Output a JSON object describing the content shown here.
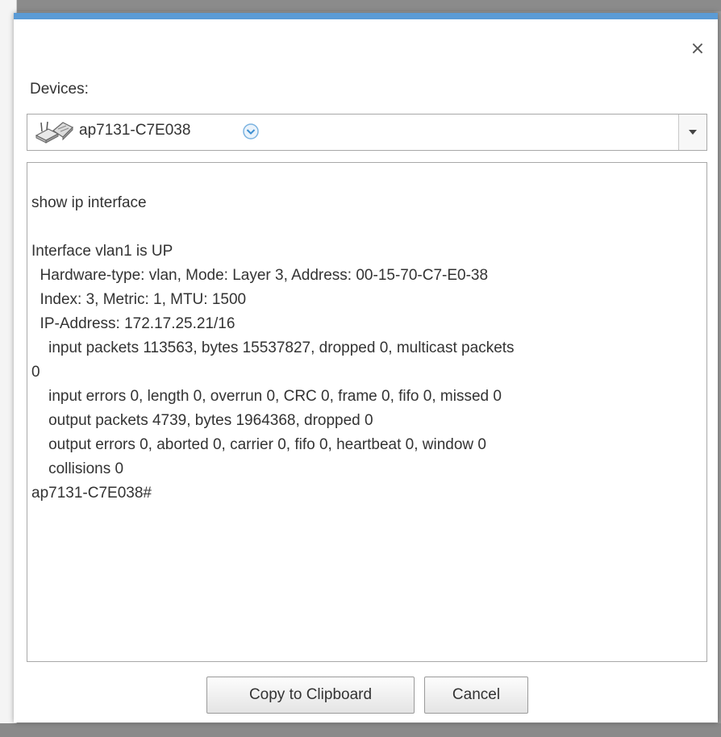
{
  "dialog": {
    "devices_label": "Devices:",
    "selected_device": "ap7131-C7E038",
    "device_icon": "access-point-icon",
    "output_lines": [
      "show ip interface",
      "",
      "Interface vlan1 is UP",
      "  Hardware-type: vlan, Mode: Layer 3, Address: 00-15-70-C7-E0-38",
      "  Index: 3, Metric: 1, MTU: 1500",
      "  IP-Address: 172.17.25.21/16",
      "    input packets 113563, bytes 15537827, dropped 0, multicast packets",
      "0",
      "    input errors 0, length 0, overrun 0, CRC 0, frame 0, fifo 0, missed 0",
      "    output packets 4739, bytes 1964368, dropped 0",
      "    output errors 0, aborted 0, carrier 0, fifo 0, heartbeat 0, window 0",
      "    collisions 0",
      "ap7131-C7E038#"
    ],
    "copy_button": "Copy to Clipboard",
    "cancel_button": "Cancel",
    "close_symbol": "×"
  },
  "colors": {
    "accent": "#5b9bd5",
    "overlay": "#9a9a9a"
  }
}
